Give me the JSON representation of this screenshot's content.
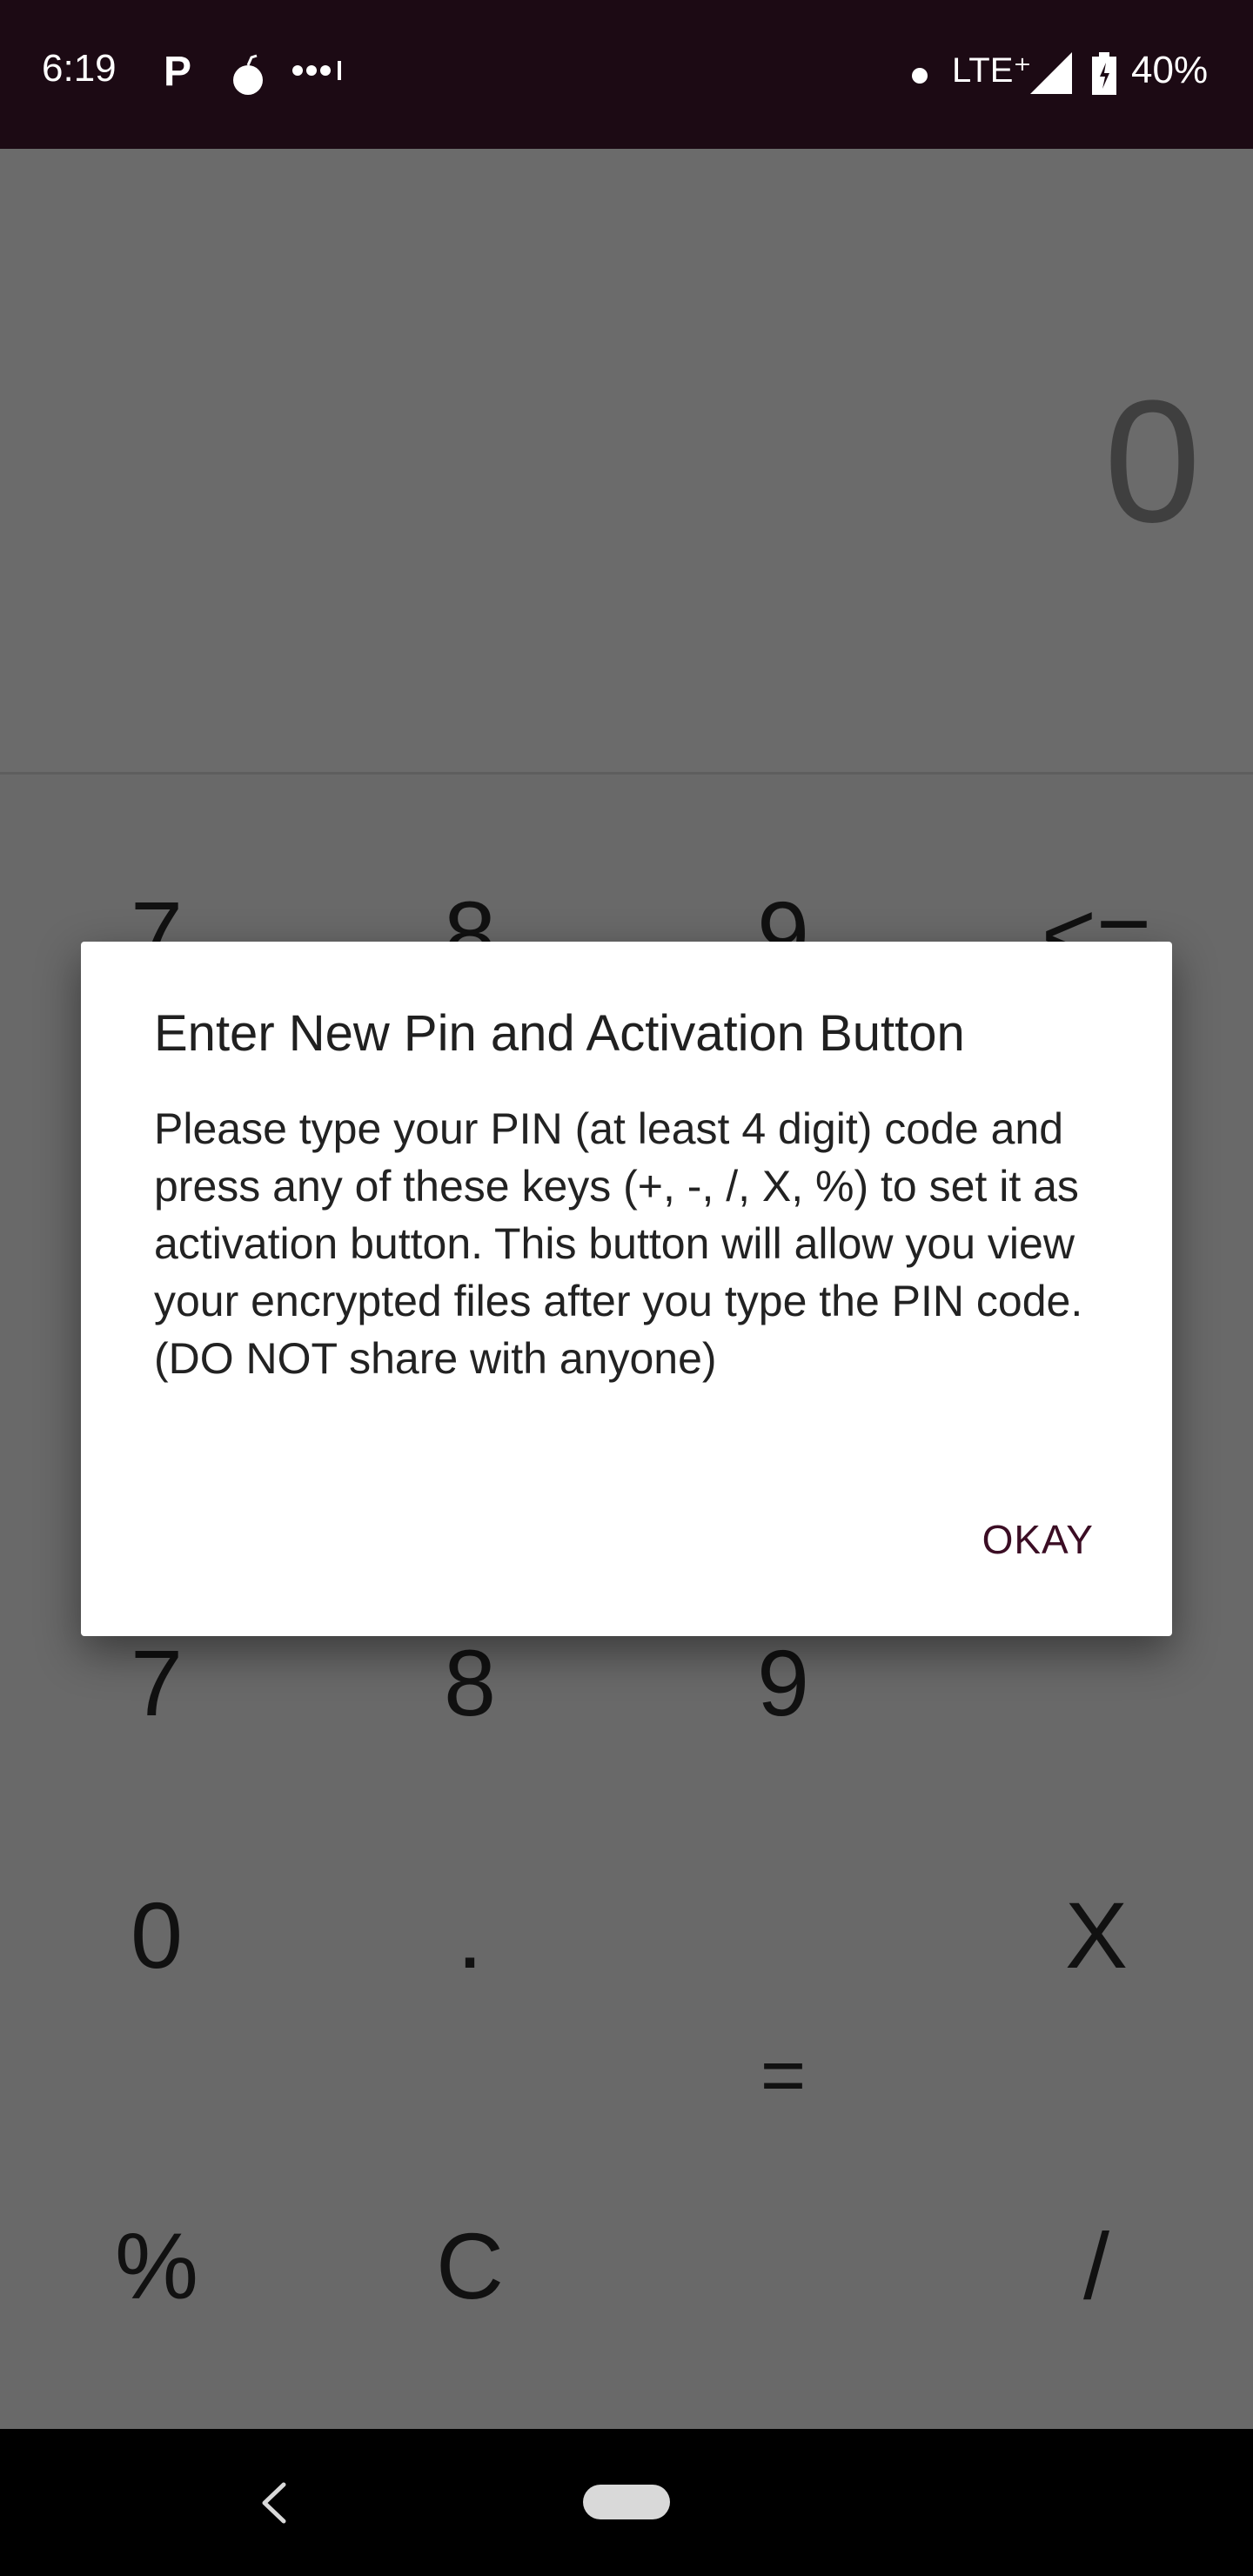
{
  "status_bar": {
    "time": "6:19",
    "p_icon": "P",
    "network": "LTE⁺",
    "battery": "40%"
  },
  "display": {
    "value": "0"
  },
  "keypad": {
    "row_top": [
      "7",
      "8",
      "9",
      "<="
    ],
    "row_mid": [
      "7",
      "8",
      "9"
    ],
    "zero": "0",
    "dot": ".",
    "x": "X",
    "equals": "=",
    "percent": "%",
    "clear": "C",
    "divide": "/"
  },
  "dialog": {
    "title": "Enter New Pin and Activation Button",
    "message": "Please type your PIN (at least 4 digit) code and press any of these keys (+, -, /, X, %) to set it as activation button. This button will allow you view your encrypted files after you type the PIN code. (DO NOT share with anyone)",
    "ok_label": "OKAY"
  },
  "colors": {
    "status_bar": "#1c0a14",
    "scrim": "#6a6a6a",
    "accent": "#3b0d24"
  },
  "icons": [
    "p-icon",
    "bomb-icon",
    "more-icon",
    "signal-icon",
    "battery-icon",
    "back-icon",
    "home-pill"
  ]
}
